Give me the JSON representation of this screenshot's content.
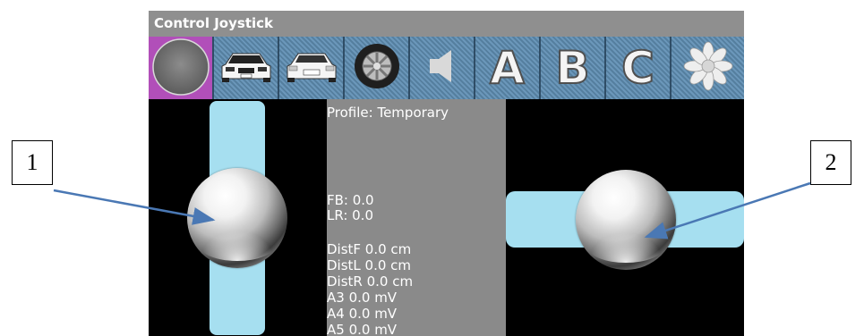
{
  "window": {
    "title": "Control Joystick"
  },
  "toolbar": {
    "buttons": [
      {
        "name": "circle",
        "icon": "gray-circle-icon",
        "active": true
      },
      {
        "name": "car-front",
        "icon": "car-front-icon"
      },
      {
        "name": "car-back",
        "icon": "car-rear-icon"
      },
      {
        "name": "wheel",
        "icon": "wheel-icon"
      },
      {
        "name": "speaker",
        "icon": "speaker-icon"
      },
      {
        "name": "a",
        "label": "A"
      },
      {
        "name": "b",
        "label": "B"
      },
      {
        "name": "c",
        "label": "C"
      },
      {
        "name": "settings",
        "icon": "gear-flower-icon"
      }
    ],
    "active_color": "#b14fb9",
    "bg_color": "#5d87a8"
  },
  "info": {
    "profile": "Profile: Temporary",
    "fb": "FB: 0.0",
    "lr": "LR: 0.0",
    "distf": "DistF 0.0 cm",
    "distl": "DistL 0.0 cm",
    "distr": "DistR 0.0 cm",
    "a3": "A3 0.0 mV",
    "a4": "A4 0.0 mV",
    "a5": "A5 0.0 mV"
  },
  "callouts": {
    "left": "1",
    "right": "2"
  },
  "colors": {
    "track": "#a6dff0",
    "panel": "#8a8a8a",
    "arrow": "#4a78b4"
  }
}
